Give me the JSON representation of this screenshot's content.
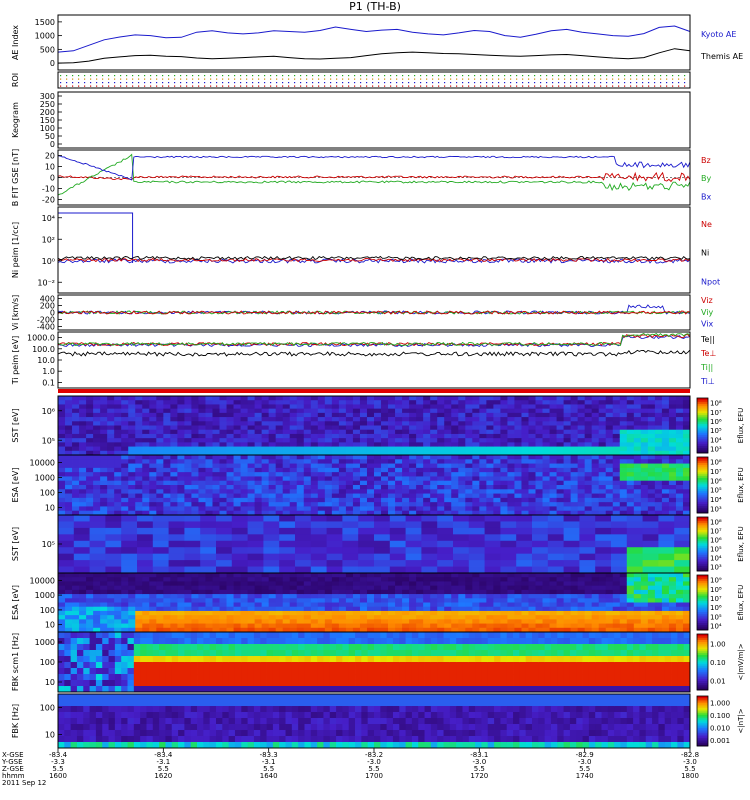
{
  "title": "P1 (TH-B)",
  "date_label": "2011 Sep 12",
  "chart_data": [
    {
      "id": "ae",
      "type": "line",
      "ylabel": "AE Index",
      "yticks": [
        "0",
        "500",
        "1000",
        "1500"
      ],
      "ylim": [
        0,
        1600
      ],
      "series": [
        {
          "name": "Kyoto AE",
          "color": "#1a1acc",
          "values": [
            520,
            560,
            720,
            880,
            960,
            1020,
            1000,
            940,
            950,
            1100,
            1140,
            1080,
            1050,
            1080,
            1140,
            1120,
            1100,
            1150,
            1250,
            1180,
            1120,
            1160,
            1180,
            1100,
            1050,
            1020,
            1080,
            1150,
            1120,
            1000,
            950,
            1040,
            1140,
            1180,
            1100,
            1050,
            1000,
            980,
            1060,
            1240,
            1280,
            1120
          ]
        },
        {
          "name": "Themis AE",
          "color": "#000000",
          "values": [
            200,
            210,
            260,
            340,
            380,
            420,
            430,
            400,
            390,
            350,
            330,
            340,
            360,
            380,
            400,
            360,
            330,
            320,
            340,
            360,
            420,
            470,
            500,
            520,
            500,
            480,
            470,
            450,
            430,
            410,
            400,
            420,
            440,
            450,
            420,
            380,
            350,
            330,
            360,
            500,
            620,
            560
          ]
        }
      ]
    },
    {
      "id": "roi",
      "type": "heatmap",
      "ylabel": "ROI",
      "note": "dotted region-of-interest indicator"
    },
    {
      "id": "keogram",
      "type": "heatmap",
      "ylabel": "Keogram",
      "yticks": [
        "0",
        "50",
        "100",
        "150",
        "200",
        "250",
        "300"
      ]
    },
    {
      "id": "bfield",
      "type": "line",
      "ylabel": "B FIT GSE [nT]",
      "yticks": [
        "-20",
        "-10",
        "0",
        "10",
        "20"
      ],
      "ylim": [
        -22,
        22
      ],
      "series": [
        {
          "name": "Bz",
          "color": "#cc0000"
        },
        {
          "name": "By",
          "color": "#22aa22"
        },
        {
          "name": "Bx",
          "color": "#1a1acc"
        }
      ]
    },
    {
      "id": "density",
      "type": "line",
      "ylabel": "Ni peim [1/cc]",
      "yticks": [
        "10⁻²",
        "10⁰",
        "10²",
        "10⁴"
      ],
      "series": [
        {
          "name": "Ne",
          "color": "#cc0000"
        },
        {
          "name": "Ni",
          "color": "#000000"
        },
        {
          "name": "Npot",
          "color": "#1a1acc"
        }
      ]
    },
    {
      "id": "velocity",
      "type": "line",
      "ylabel": "Vi [km/s]",
      "yticks": [
        "-400",
        "-200",
        "0",
        "200",
        "400"
      ],
      "ylim": [
        -500,
        500
      ],
      "series": [
        {
          "name": "Viz",
          "color": "#cc0000"
        },
        {
          "name": "Viy",
          "color": "#22aa22"
        },
        {
          "name": "Vix",
          "color": "#1a1acc"
        }
      ]
    },
    {
      "id": "temperature",
      "type": "line",
      "ylabel": "Ti peim [eV]",
      "yticks": [
        "0.1",
        "1.0",
        "10.0",
        "100.0",
        "1000.0"
      ],
      "series": [
        {
          "name": "Te||",
          "color": "#000000"
        },
        {
          "name": "Te⊥",
          "color": "#cc0000"
        },
        {
          "name": "Ti||",
          "color": "#22aa22"
        },
        {
          "name": "Ti⊥",
          "color": "#1a1acc"
        }
      ]
    },
    {
      "id": "sst_e",
      "type": "heatmap",
      "ylabel": "SST [eV]",
      "yticks": [
        "10⁵",
        "10⁶"
      ],
      "colorbar_label": "Eflux, EFU",
      "colorbar_ticks": [
        "10³",
        "10⁴",
        "10⁵",
        "10⁶",
        "10⁷",
        "10⁸"
      ]
    },
    {
      "id": "esa_i",
      "type": "heatmap",
      "ylabel": "ESA [eV]",
      "yticks": [
        "10",
        "100",
        "1000",
        "10000"
      ],
      "colorbar_label": "Eflux, EFU",
      "colorbar_ticks": [
        "10³",
        "10⁴",
        "10⁵",
        "10⁶",
        "10⁷",
        "10⁸"
      ]
    },
    {
      "id": "sst_i",
      "type": "heatmap",
      "ylabel": "SST [eV]",
      "yticks": [
        "10⁵"
      ],
      "colorbar_label": "Eflux, EFU",
      "colorbar_ticks": [
        "10³",
        "10⁴",
        "10⁵",
        "10⁶",
        "10⁷",
        "10⁸"
      ]
    },
    {
      "id": "esa_e",
      "type": "heatmap",
      "ylabel": "ESA [eV]",
      "yticks": [
        "10",
        "100",
        "1000",
        "10000"
      ],
      "colorbar_label": "Eflux, EFU",
      "colorbar_ticks": [
        "10⁴",
        "10⁵",
        "10⁶",
        "10⁷",
        "10⁸",
        "10⁹"
      ]
    },
    {
      "id": "fbk_b",
      "type": "heatmap",
      "ylabel": "FBK scm1 [Hz]",
      "yticks": [
        "10",
        "100",
        "1000"
      ],
      "colorbar_label": "<|mV/m|>",
      "colorbar_ticks": [
        "0.01",
        "0.10",
        "1.00"
      ]
    },
    {
      "id": "fbk_e",
      "type": "heatmap",
      "ylabel": "FBK [Hz]",
      "yticks": [
        "10",
        "100"
      ],
      "colorbar_label": "<|nT|>",
      "colorbar_ticks": [
        "0.001",
        "0.010",
        "0.100",
        "1.000"
      ]
    }
  ],
  "xaxis": {
    "row_labels": [
      "X-GSE",
      "Y-GSE",
      "Z-GSE",
      "hhmm"
    ],
    "ticks": [
      {
        "x": "-83.4",
        "y": "-3.3",
        "z": "5.5",
        "t": "1600"
      },
      {
        "x": "-83.4",
        "y": "-3.1",
        "z": "5.5",
        "t": "1620"
      },
      {
        "x": "-83.3",
        "y": "-3.1",
        "z": "5.5",
        "t": "1640"
      },
      {
        "x": "-83.2",
        "y": "-3.0",
        "z": "5.5",
        "t": "1700"
      },
      {
        "x": "-83.1",
        "y": "-3.0",
        "z": "5.5",
        "t": "1720"
      },
      {
        "x": "-82.9",
        "y": "-3.0",
        "z": "5.5",
        "t": "1740"
      },
      {
        "x": "-82.8",
        "y": "-3.0",
        "z": "5.5",
        "t": "1800"
      }
    ]
  },
  "colors": {
    "background": "#ffffff",
    "spectrogram_low": "#0b0b6e",
    "spectrogram_high": "#e00000"
  }
}
